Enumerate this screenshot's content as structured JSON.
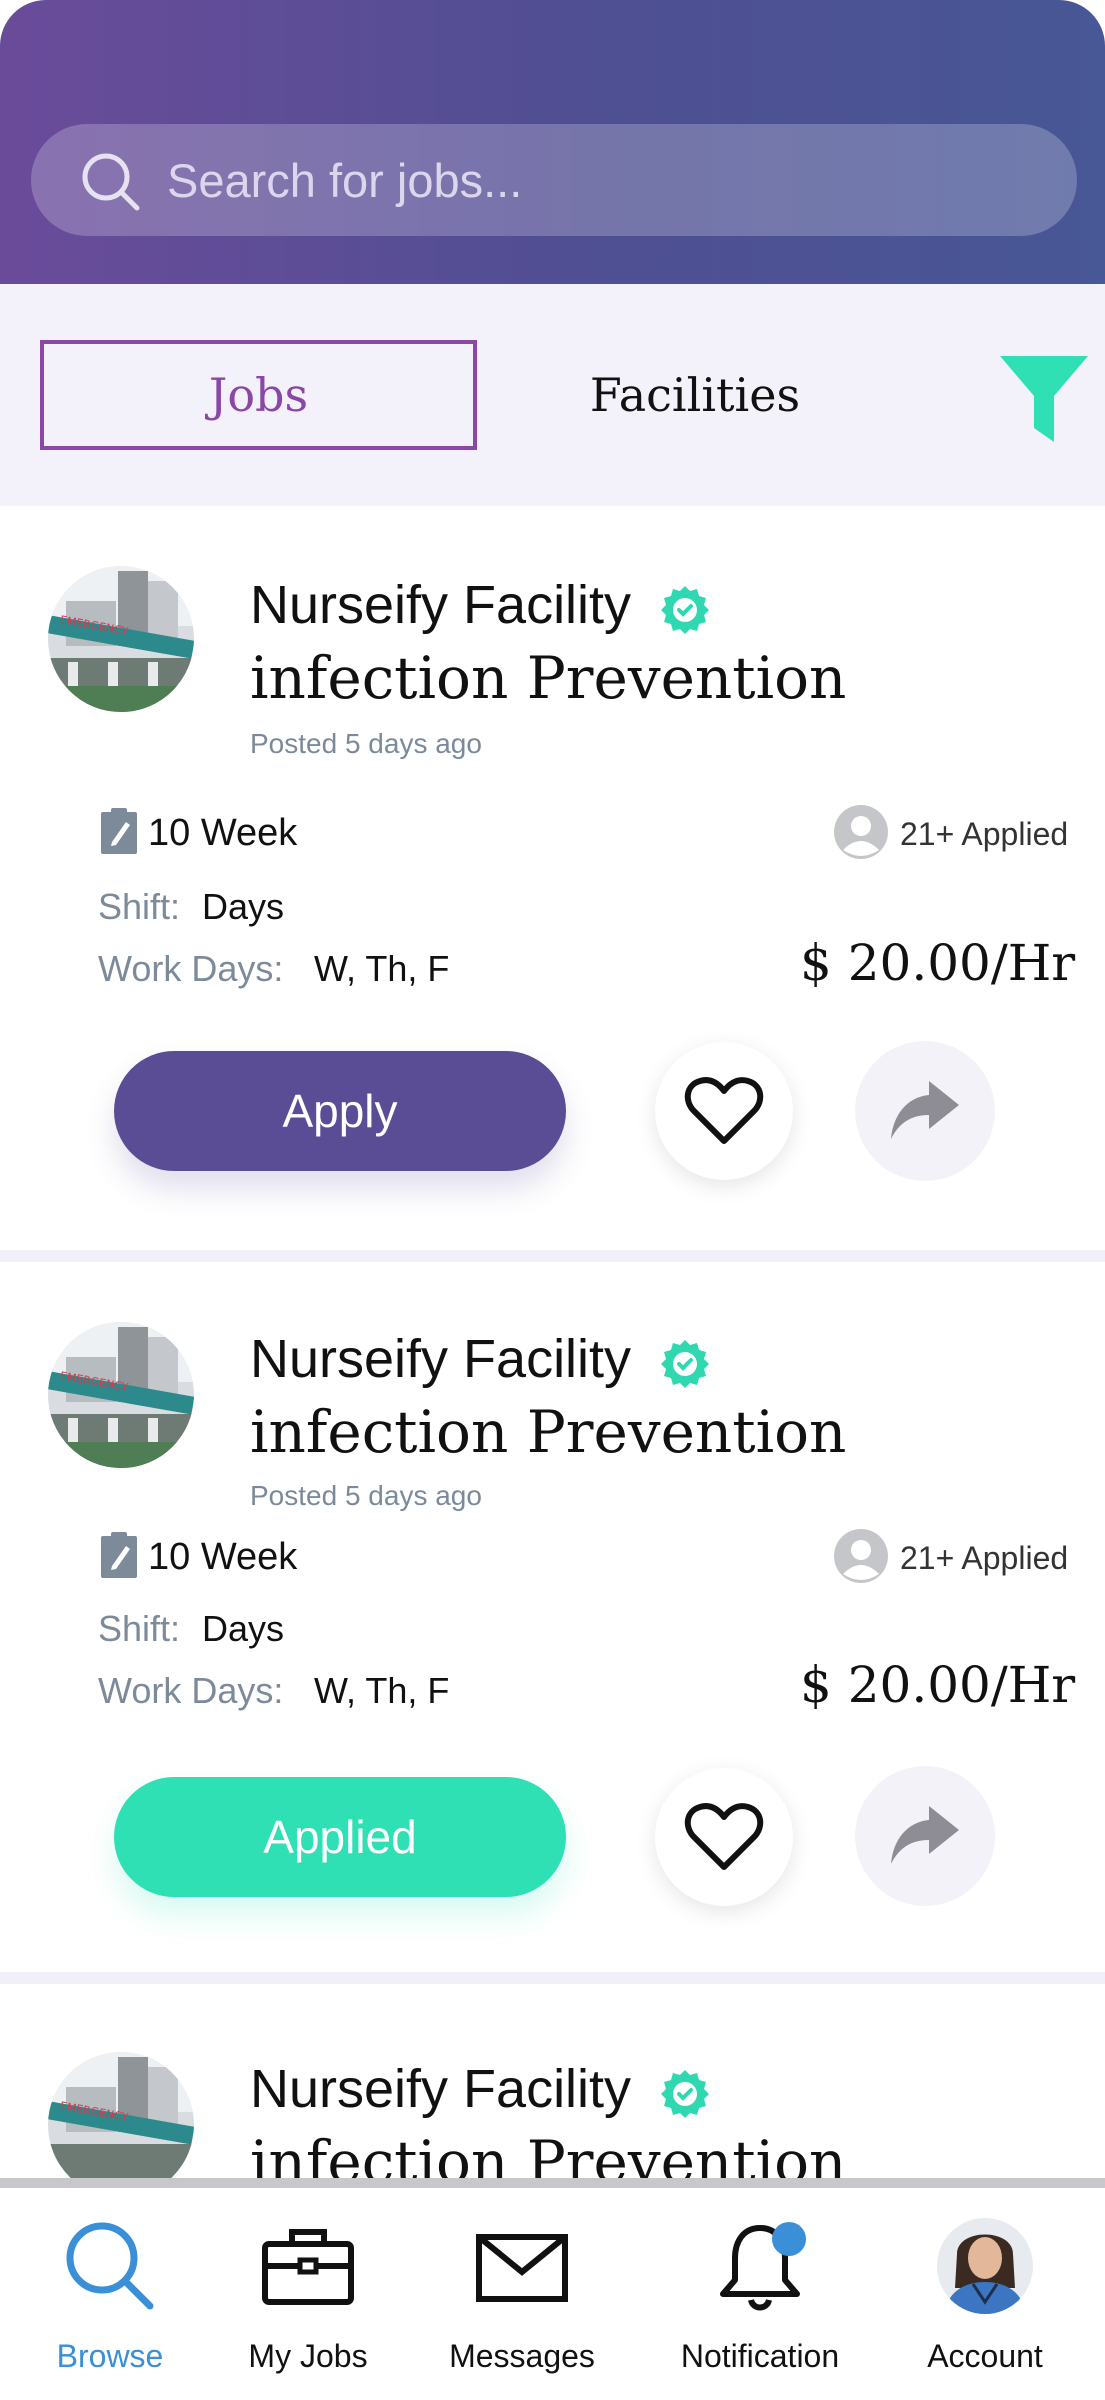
{
  "search": {
    "placeholder": "Search for jobs..."
  },
  "tabs": {
    "jobs": "Jobs",
    "facilities": "Facilities"
  },
  "jobs": [
    {
      "facility": "Nurseify Facility",
      "title": "infection Prevention",
      "posted": "Posted 5 days ago",
      "duration": "10 Week",
      "applied": "21+ Applied",
      "shift_label": "Shift:",
      "shift": "Days",
      "workdays_label": "Work Days:",
      "workdays": "W, Th, F",
      "price": "$ 20.00/Hr",
      "action": "Apply"
    },
    {
      "facility": "Nurseify Facility",
      "title": "infection Prevention",
      "posted": "Posted 5 days ago",
      "duration": "10 Week",
      "applied": "21+ Applied",
      "shift_label": "Shift:",
      "shift": "Days",
      "workdays_label": "Work Days:",
      "workdays": "W, Th, F",
      "price": "$ 20.00/Hr",
      "action": "Applied"
    },
    {
      "facility": "Nurseify Facility",
      "title": "infection Prevention"
    }
  ],
  "nav": {
    "browse": "Browse",
    "my_jobs": "My Jobs",
    "messages": "Messages",
    "notification": "Notification",
    "account": "Account"
  },
  "colors": {
    "header_start": "#6a4b9a",
    "header_end": "#485796",
    "accent_purple": "#8a47a6",
    "apply_button": "#5b4d95",
    "applied_button": "#2fe0b5",
    "verified_badge": "#2fd8b0",
    "active_nav": "#3a8fd6"
  },
  "icons": {
    "search": "search-icon",
    "filter": "filter-icon",
    "verified": "verified-badge-icon",
    "duration": "clipboard-icon",
    "applicants": "user-avatar-icon",
    "favorite": "heart-icon",
    "share": "share-icon",
    "browse": "search-icon",
    "my_jobs": "briefcase-icon",
    "messages": "envelope-icon",
    "notification": "bell-icon"
  }
}
